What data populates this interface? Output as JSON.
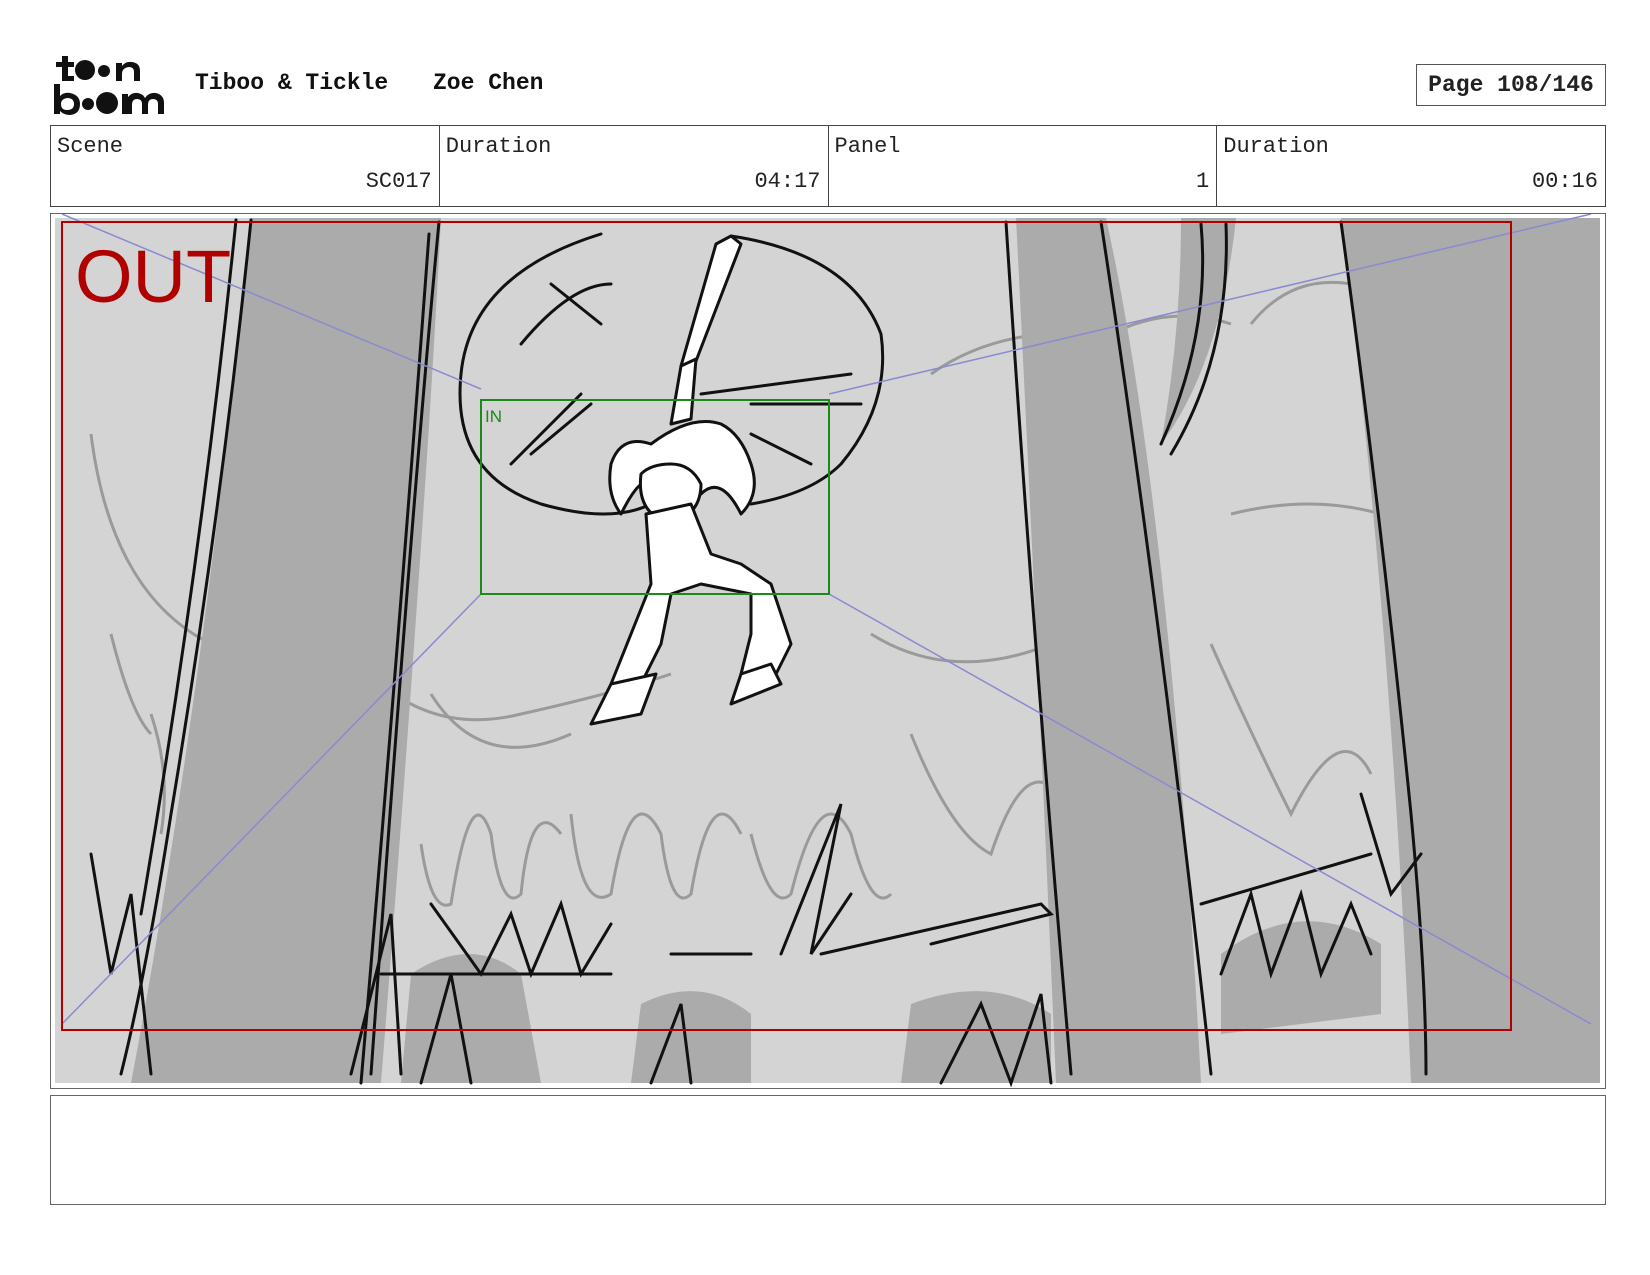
{
  "header": {
    "project": "Tiboo & Tickle",
    "artist": "Zoe Chen",
    "page": "Page 108/146"
  },
  "logo": {
    "text": "toon boom"
  },
  "info": {
    "scene_label": "Scene",
    "scene_value": "SC017",
    "scene_duration_label": "Duration",
    "scene_duration_value": "04:17",
    "panel_label": "Panel",
    "panel_value": "1",
    "panel_duration_label": "Duration",
    "panel_duration_value": "00:16"
  },
  "frame": {
    "out_label": "OUT",
    "in_label": "IN",
    "out_color": "#b00000",
    "in_color": "#1a8a1a",
    "guide_color": "#7a7ac8"
  },
  "notes": {
    "text": ""
  }
}
